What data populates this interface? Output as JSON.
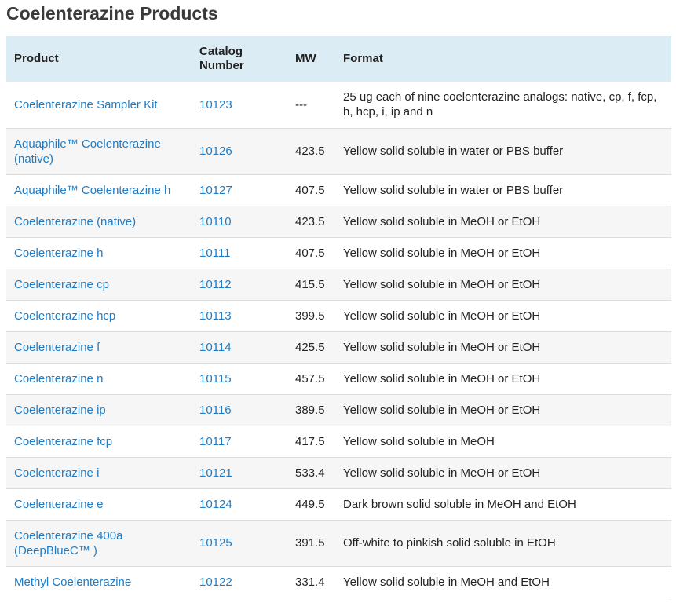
{
  "page": {
    "title": "Coelenterazine Products"
  },
  "table": {
    "headers": [
      "Product",
      "Catalog Number",
      "MW",
      "Format"
    ],
    "rows": [
      {
        "product": "Coelenterazine Sampler Kit",
        "catalog": "10123",
        "mw": "---",
        "format": "25 ug each of nine coelenterazine analogs: native, cp, f, fcp, h, hcp, i, ip and n",
        "tall": true
      },
      {
        "product": "Aquaphile™ Coelenterazine (native)",
        "catalog": "10126",
        "mw": "423.5",
        "format": "Yellow solid soluble in water or PBS buffer",
        "tall": true
      },
      {
        "product": "Aquaphile™ Coelenterazine h",
        "catalog": "10127",
        "mw": "407.5",
        "format": "Yellow solid soluble in water or PBS buffer"
      },
      {
        "product": "Coelenterazine (native)",
        "catalog": "10110",
        "mw": "423.5",
        "format": "Yellow solid soluble in MeOH or EtOH"
      },
      {
        "product": "Coelenterazine h",
        "catalog": "10111",
        "mw": "407.5",
        "format": "Yellow solid soluble in MeOH or EtOH"
      },
      {
        "product": "Coelenterazine cp",
        "catalog": "10112",
        "mw": "415.5",
        "format": "Yellow solid soluble in MeOH or EtOH"
      },
      {
        "product": "Coelenterazine hcp",
        "catalog": "10113",
        "mw": "399.5",
        "format": "Yellow solid soluble in MeOH or EtOH"
      },
      {
        "product": "Coelenterazine f",
        "catalog": "10114",
        "mw": "425.5",
        "format": "Yellow solid soluble in MeOH or EtOH"
      },
      {
        "product": "Coelenterazine n",
        "catalog": "10115",
        "mw": "457.5",
        "format": "Yellow solid soluble in MeOH or EtOH"
      },
      {
        "product": "Coelenterazine ip",
        "catalog": "10116",
        "mw": "389.5",
        "format": "Yellow solid soluble in MeOH or EtOH"
      },
      {
        "product": "Coelenterazine fcp",
        "catalog": "10117",
        "mw": "417.5",
        "format": "Yellow solid soluble in MeOH"
      },
      {
        "product": "Coelenterazine i",
        "catalog": "10121",
        "mw": "533.4",
        "format": "Yellow solid soluble in MeOH or EtOH"
      },
      {
        "product": "Coelenterazine e",
        "catalog": "10124",
        "mw": "449.5",
        "format": "Dark brown solid soluble in MeOH and EtOH"
      },
      {
        "product": "Coelenterazine 400a (DeepBlueC™ )",
        "catalog": "10125",
        "mw": "391.5",
        "format": "Off-white to pinkish solid soluble in EtOH",
        "tall": true
      },
      {
        "product": "Methyl Coelenterazine",
        "catalog": "10122",
        "mw": "331.4",
        "format": "Yellow solid soluble in MeOH and EtOH"
      }
    ]
  },
  "colors": {
    "link": "#1f7cc4",
    "header_bg": "#dcecf5",
    "stripe": "#f6f6f6"
  }
}
